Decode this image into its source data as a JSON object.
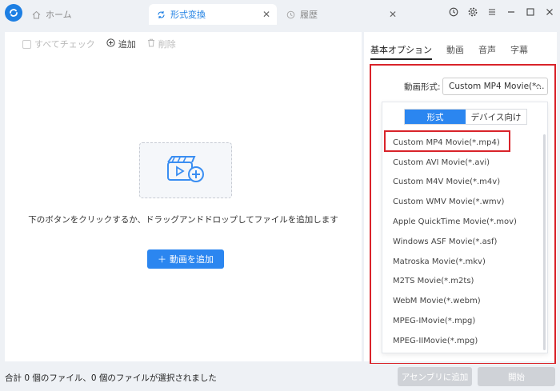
{
  "titlebar": {
    "tabs": [
      {
        "label": "ホーム",
        "icon": "home-icon"
      },
      {
        "label": "形式変換",
        "icon": "refresh-icon"
      },
      {
        "label": "履歴",
        "icon": "history-icon"
      }
    ],
    "window_controls": [
      "clock-icon",
      "gear-icon",
      "menu-icon",
      "minimize-icon",
      "maximize-icon",
      "close-icon"
    ]
  },
  "left": {
    "toolbar": {
      "check_all": "すべてチェック",
      "add": "追加",
      "delete": "削除"
    },
    "drop_text": "下のボタンをクリックするか、ドラッグアンドドロップしてファイルを追加します",
    "add_video": "動画を追加"
  },
  "right": {
    "tabs": [
      "基本オプション",
      "動画",
      "音声",
      "字幕"
    ],
    "format_label": "動画形式:",
    "format_value": "Custom MP4 Movie(*...",
    "segments": [
      "形式",
      "デバイス向け"
    ],
    "formats": [
      "Custom MP4 Movie(*.mp4)",
      "Custom AVI Movie(*.avi)",
      "Custom M4V Movie(*.m4v)",
      "Custom WMV Movie(*.wmv)",
      "Apple QuickTime Movie(*.mov)",
      "Windows ASF Movie(*.asf)",
      "Matroska Movie(*.mkv)",
      "M2TS Movie(*.m2ts)",
      "WebM Movie(*.webm)",
      "MPEG-IMovie(*.mpg)",
      "MPEG-IIMovie(*.mpg)"
    ]
  },
  "status": {
    "text": "合計 0 個のファイル、0 個のファイルが選択されました",
    "assembly": "アセンブリに追加",
    "start": "開始"
  },
  "colors": {
    "accent": "#2b86f0",
    "highlight": "#d9232a"
  }
}
